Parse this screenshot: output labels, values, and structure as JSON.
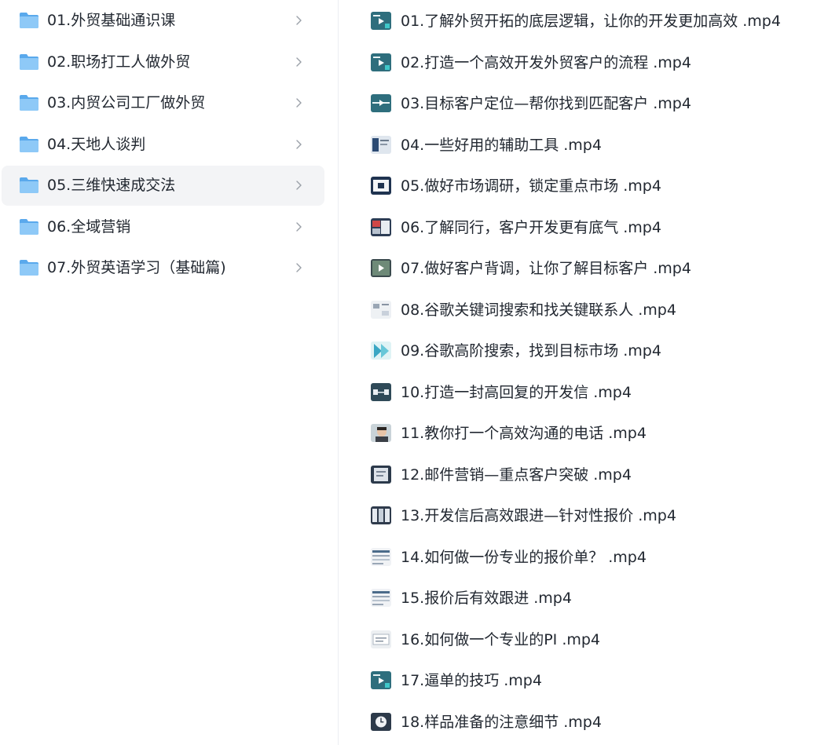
{
  "folders": [
    {
      "label": "01.外贸基础通识课",
      "selected": false
    },
    {
      "label": "02.职场打工人做外贸",
      "selected": false
    },
    {
      "label": "03.内贸公司工厂做外贸",
      "selected": false
    },
    {
      "label": "04.天地人谈判",
      "selected": false
    },
    {
      "label": "05.三维快速成交法",
      "selected": true
    },
    {
      "label": "06.全域营销",
      "selected": false
    },
    {
      "label": "07.外贸英语学习（基础篇)",
      "selected": false
    }
  ],
  "files": [
    {
      "label": "01.了解外贸开拓的底层逻辑，让你的开发更加高效 .mp4",
      "thumb": "teal-play-thumb"
    },
    {
      "label": "02.打造一个高效开发外贸客户的流程 .mp4",
      "thumb": "teal-play-thumb"
    },
    {
      "label": "03.目标客户定位—帮你找到匹配客户 .mp4",
      "thumb": "teal-diagram-thumb"
    },
    {
      "label": "04.一些好用的辅助工具 .mp4",
      "thumb": "slide-thumb"
    },
    {
      "label": "05.做好市场调研，锁定重点市场 .mp4",
      "thumb": "dark-slide-thumb"
    },
    {
      "label": "06.了解同行，客户开发更有底气 .mp4",
      "thumb": "red-slide-thumb"
    },
    {
      "label": "07.做好客户背调，让你了解目标客户 .mp4",
      "thumb": "dark-play-thumb"
    },
    {
      "label": "08.谷歌关键词搜索和找关键联系人 .mp4",
      "thumb": "light-grid-thumb"
    },
    {
      "label": "09.谷歌高阶搜索，找到目标市场 .mp4",
      "thumb": "light-teal-thumb"
    },
    {
      "label": "10.打造一封高回复的开发信 .mp4",
      "thumb": "dark-diagram-thumb"
    },
    {
      "label": "11.教你打一个高效沟通的电话 .mp4",
      "thumb": "portrait-thumb"
    },
    {
      "label": "12.邮件营销—重点客户突破 .mp4",
      "thumb": "dark-frame-thumb"
    },
    {
      "label": "13.开发信后高效跟进—针对性报价 .mp4",
      "thumb": "dark-columns-thumb"
    },
    {
      "label": "14.如何做一份专业的报价单？ .mp4",
      "thumb": "light-table-thumb"
    },
    {
      "label": "15.报价后有效跟进 .mp4",
      "thumb": "light-table-thumb"
    },
    {
      "label": "16.如何做一个专业的PI .mp4",
      "thumb": "light-doc-thumb"
    },
    {
      "label": "17.逼单的技巧 .mp4",
      "thumb": "teal-play-thumb"
    },
    {
      "label": "18.样品准备的注意细节 .mp4",
      "thumb": "clock-thumb"
    }
  ],
  "colors": {
    "folder": "#7fc0f5",
    "selected_bg": "#f3f4f6",
    "text": "#222831",
    "teal": "#2f6f7c"
  }
}
